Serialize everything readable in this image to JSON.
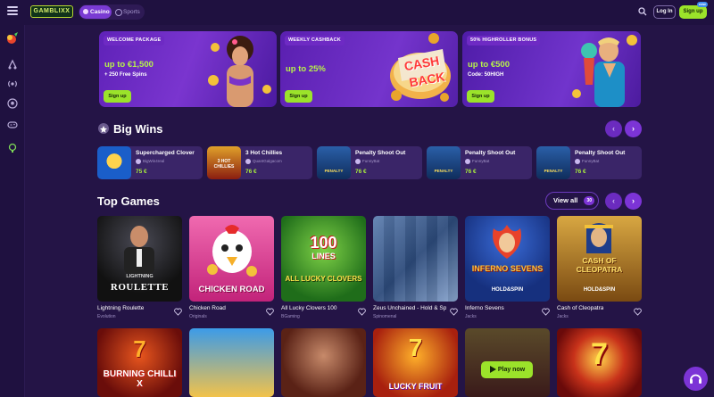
{
  "header": {
    "logo_text": "GAMBLIXX",
    "tabs": [
      {
        "label": "Casino",
        "active": true
      },
      {
        "label": "Sports",
        "active": false
      }
    ],
    "login_label": "Log In",
    "signup_label": "Sign up",
    "signup_badge": "new"
  },
  "sidebar": {
    "icons": [
      "casino-chip-icon",
      "sports-icon",
      "live-icon",
      "soccer-ball-icon",
      "gamepad-icon",
      "support-icon"
    ]
  },
  "promos": [
    {
      "badge": "WELCOME PACKAGE",
      "headline": "up to €1,500",
      "sub": "+ 250 Free Spins",
      "cta": "Sign up"
    },
    {
      "badge": "WEEKLY CASHBACK",
      "headline": "up to 25%",
      "art_text_1": "CASH",
      "art_text_2": "BACK",
      "cta": "Sign up"
    },
    {
      "badge": "50% HIGHROLLER BONUS",
      "headline": "up to €500",
      "sub": "Code: 50HIGH",
      "cta": "Sign up"
    }
  ],
  "big_wins": {
    "title": "Big Wins",
    "prev": "‹",
    "next": "›",
    "items": [
      {
        "game": "Supercharged Clover",
        "user": "BigWin4real",
        "amount": "75 €"
      },
      {
        "game": "3 Hot Chillies",
        "user": "QuantGalgacom",
        "amount": "76 €"
      },
      {
        "game": "Penalty Shoot Out",
        "user": "FunnyBat",
        "amount": "76 €"
      },
      {
        "game": "Penalty Shoot Out",
        "user": "FunnyBat",
        "amount": "76 €"
      },
      {
        "game": "Penalty Shoot Out",
        "user": "FunnyBat",
        "amount": "76 €"
      }
    ],
    "thumb_texts": [
      "",
      "3 HOT CHILLIES",
      "PENALTY",
      "PENALTY",
      "PENALTY"
    ]
  },
  "top_games": {
    "title": "Top Games",
    "view_all": "View all",
    "view_all_count": "30",
    "prev": "‹",
    "next": "›",
    "play_now": "Play now",
    "row1": [
      {
        "name": "Lightning Roulette",
        "provider": "Evolution",
        "art": "LIGHTNING ROULETTE",
        "art_label": "LIGHTNING"
      },
      {
        "name": "Chicken Road",
        "provider": "Originals",
        "art": "CHICKEN ROAD"
      },
      {
        "name": "All Lucky Clovers 100",
        "provider": "BGaming",
        "art": "100",
        "art2": "LINES",
        "art3": "ALL LUCKY CLOVERS"
      },
      {
        "name": "Zeus Unchained - Hold & Spin",
        "provider": "Spinomenal"
      },
      {
        "name": "Inferno Sevens",
        "provider": "Jacks",
        "art": "INFERNO SEVENS",
        "art2": "HOLD&SPIN"
      },
      {
        "name": "Cash of Cleopatra",
        "provider": "Jacks",
        "art": "CASH OF CLEOPATRA",
        "art2": "HOLD&SPIN"
      }
    ],
    "row2_art": [
      "BURNING CHILLI X",
      "",
      "",
      "LUCKY FRUIT",
      "",
      "7"
    ]
  }
}
